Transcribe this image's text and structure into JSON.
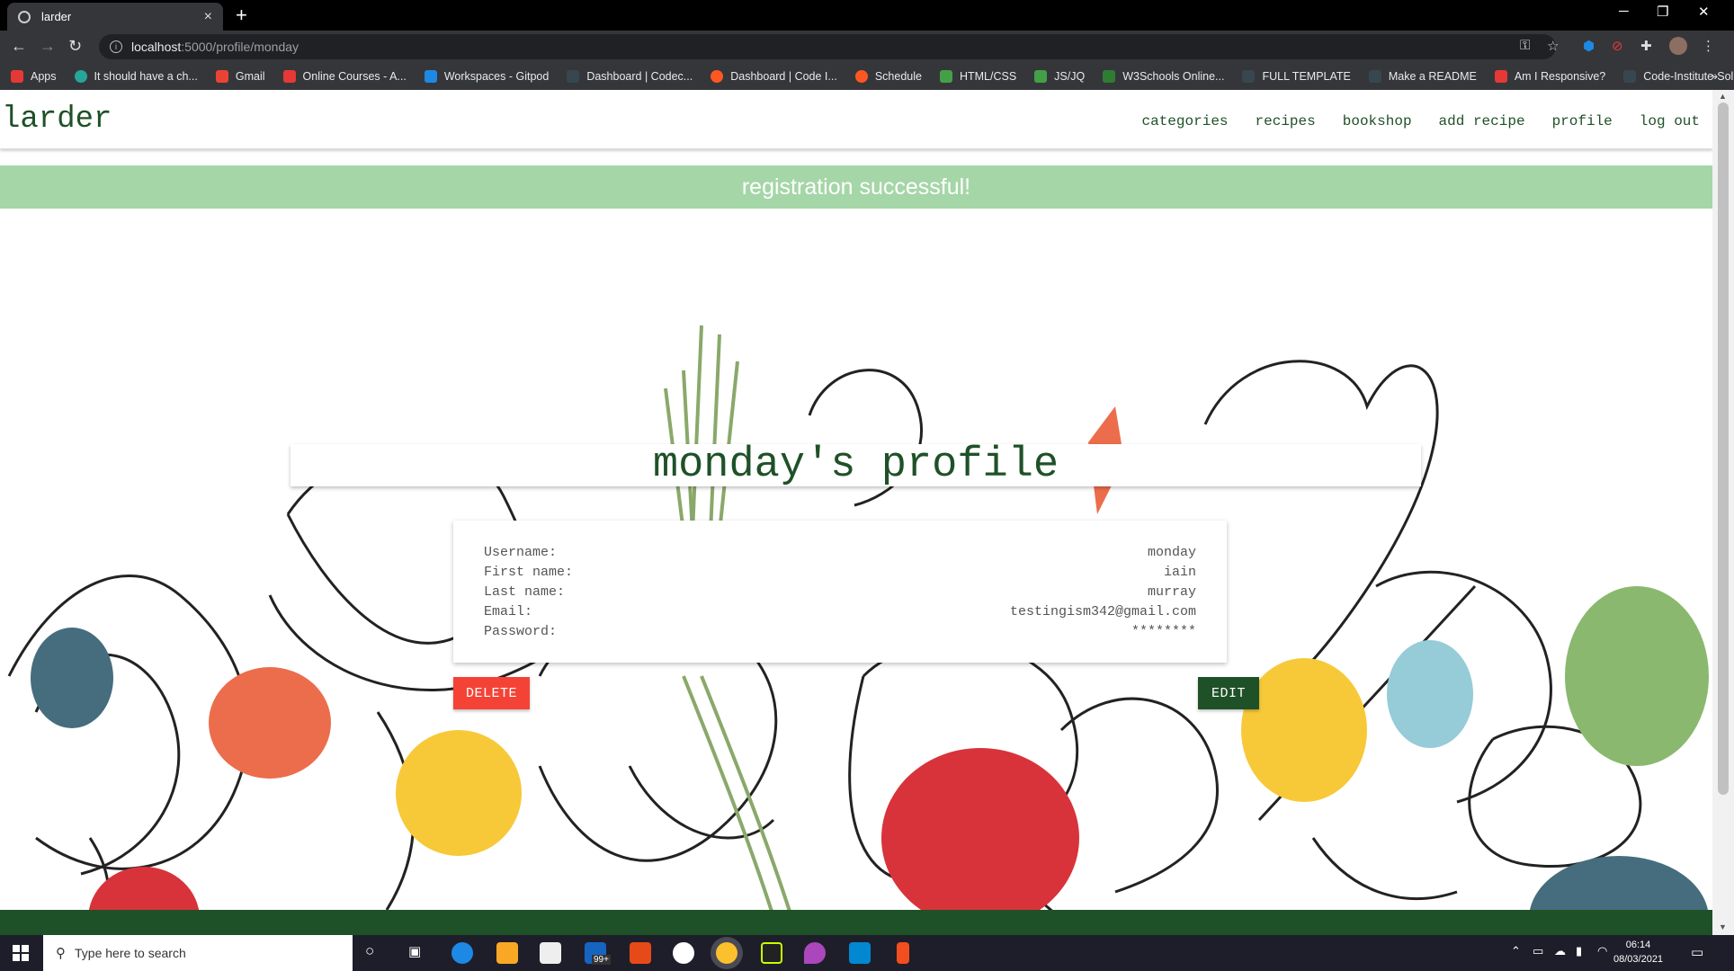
{
  "browser": {
    "tab_title": "larder",
    "tab_close": "×",
    "new_tab": "+",
    "url_host": "localhost",
    "url_path": ":5000/profile/monday",
    "bookmarks": [
      {
        "label": "Apps",
        "color": "#e53935"
      },
      {
        "label": "It should have a ch...",
        "color": "#26a69a"
      },
      {
        "label": "Gmail",
        "color": "#ea4335"
      },
      {
        "label": "Online Courses - A...",
        "color": "#e53935"
      },
      {
        "label": "Workspaces - Gitpod",
        "color": "#1e88e5"
      },
      {
        "label": "Dashboard | Codec...",
        "color": "#37474f"
      },
      {
        "label": "Dashboard | Code I...",
        "color": "#ff5722"
      },
      {
        "label": "Schedule",
        "color": "#ff5722"
      },
      {
        "label": "HTML/CSS",
        "color": "#43a047"
      },
      {
        "label": "JS/JQ",
        "color": "#43a047"
      },
      {
        "label": "W3Schools Online...",
        "color": "#2e7d32"
      },
      {
        "label": "FULL TEMPLATE",
        "color": "#37474f"
      },
      {
        "label": "Make a README",
        "color": "#37474f"
      },
      {
        "label": "Am I Responsive?",
        "color": "#e53935"
      },
      {
        "label": "Code-Institute-Solu...",
        "color": "#37474f"
      }
    ]
  },
  "nav": {
    "brand": "larder",
    "links": [
      "categories",
      "recipes",
      "bookshop",
      "add recipe",
      "profile",
      "log out"
    ]
  },
  "flash": "registration successful!",
  "profile": {
    "title": "monday's profile",
    "rows": [
      {
        "label": "Username:",
        "value": "monday"
      },
      {
        "label": "First name:",
        "value": "iain"
      },
      {
        "label": "Last name:",
        "value": "murray"
      },
      {
        "label": "Email:",
        "value": "testingism342@gmail.com"
      },
      {
        "label": "Password:",
        "value": "********"
      }
    ],
    "delete_label": "DELETE",
    "edit_label": "EDIT"
  },
  "colors": {
    "brand_green": "#1f5128",
    "flash_green": "#a5d6a7",
    "delete_red": "#f44336"
  },
  "taskbar": {
    "search_placeholder": "Type here to search",
    "time": "06:14",
    "date": "08/03/2021",
    "mail_badge": "99+"
  }
}
